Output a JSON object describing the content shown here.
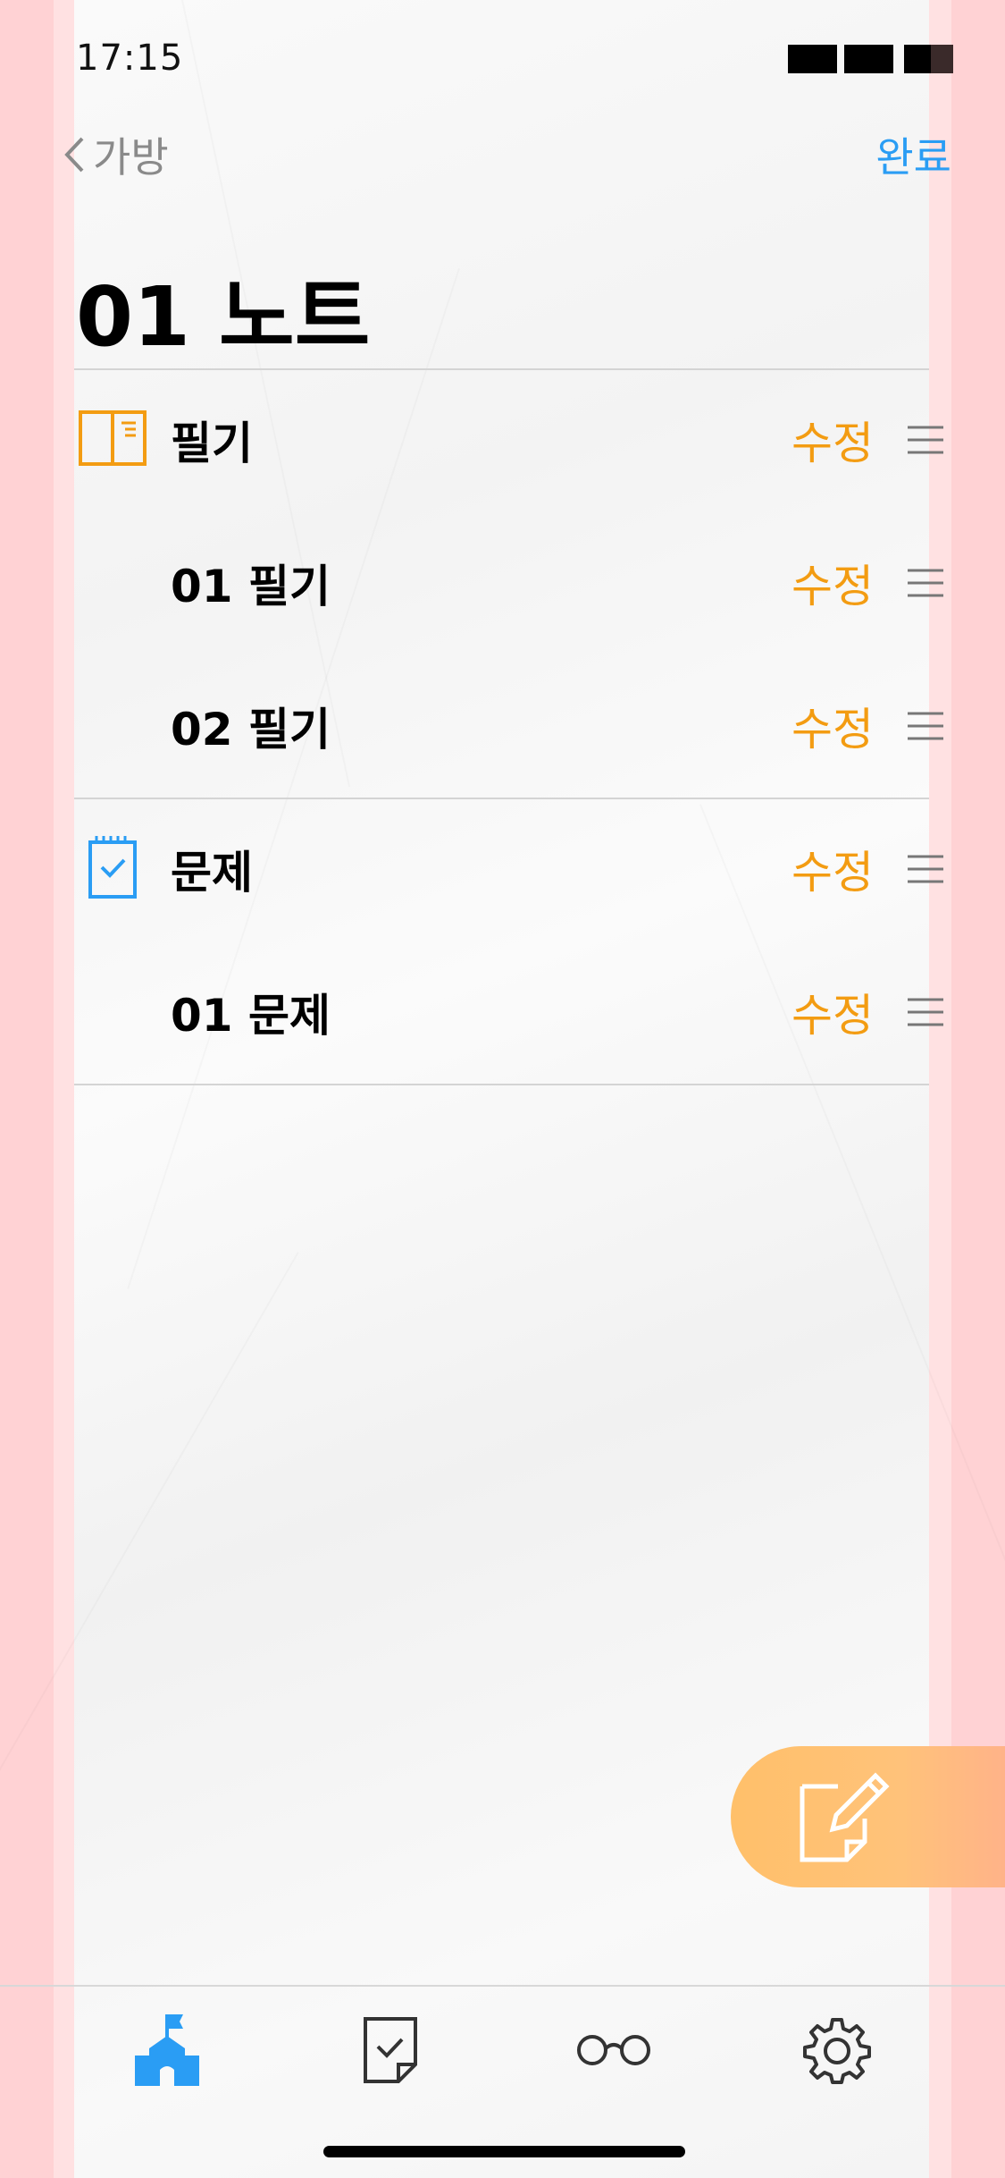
{
  "status": {
    "time": "17:15"
  },
  "nav": {
    "back_label": "가방",
    "done_label": "완료"
  },
  "page": {
    "title": "01 노트"
  },
  "sections": [
    {
      "title": "필기",
      "icon": "notebook-icon",
      "edit_label": "수정",
      "items": [
        {
          "title": "01 필기",
          "edit_label": "수정"
        },
        {
          "title": "02 필기",
          "edit_label": "수정"
        }
      ]
    },
    {
      "title": "문제",
      "icon": "checklist-icon",
      "edit_label": "수정",
      "items": [
        {
          "title": "01 문제",
          "edit_label": "수정"
        }
      ]
    }
  ],
  "fab": {
    "icon": "compose-icon"
  },
  "tabbar": {
    "tabs": [
      {
        "icon": "school-icon",
        "active": true
      },
      {
        "icon": "document-check-icon",
        "active": false
      },
      {
        "icon": "glasses-icon",
        "active": false
      },
      {
        "icon": "gear-icon",
        "active": false
      }
    ]
  },
  "colors": {
    "accent_blue": "#2a9df4",
    "accent_orange": "#f39c12",
    "fab_orange": "#ffc06a",
    "side_pink": "#ffd2d4"
  }
}
